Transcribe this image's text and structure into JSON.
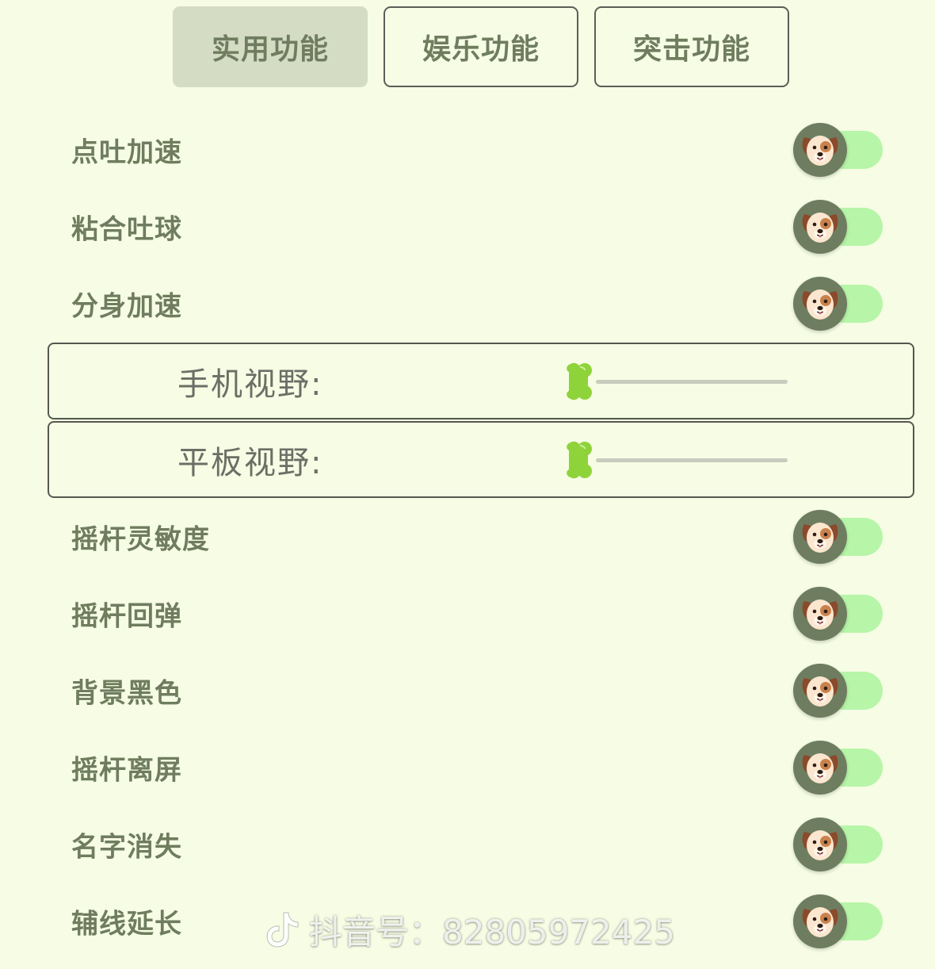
{
  "tabs": [
    {
      "label": "实用功能",
      "active": true
    },
    {
      "label": "娱乐功能",
      "active": false
    },
    {
      "label": "突击功能",
      "active": false
    }
  ],
  "toggles_top": [
    {
      "label": "点吐加速"
    },
    {
      "label": "粘合吐球"
    },
    {
      "label": "分身加速"
    }
  ],
  "sliders": [
    {
      "label": "手机视野:",
      "value": 0
    },
    {
      "label": "平板视野:",
      "value": 0
    }
  ],
  "toggles_bottom": [
    {
      "label": "摇杆灵敏度"
    },
    {
      "label": "摇杆回弹"
    },
    {
      "label": "背景黑色"
    },
    {
      "label": "摇杆离屏"
    },
    {
      "label": "名字消失"
    },
    {
      "label": "辅线延长"
    }
  ],
  "icons": {
    "toggle_knob": "dog-face-icon",
    "slider_thumb": "bone-icon",
    "watermark": "tiktok-logo-icon"
  },
  "colors": {
    "background": "#f6fde4",
    "label_text": "#6f7d5e",
    "toggle_track": "#b7f5a8",
    "toggle_knob": "#6e7d5f",
    "slider_thumb": "#8fd33a"
  },
  "watermark": {
    "text": "抖音号：82805972425"
  }
}
